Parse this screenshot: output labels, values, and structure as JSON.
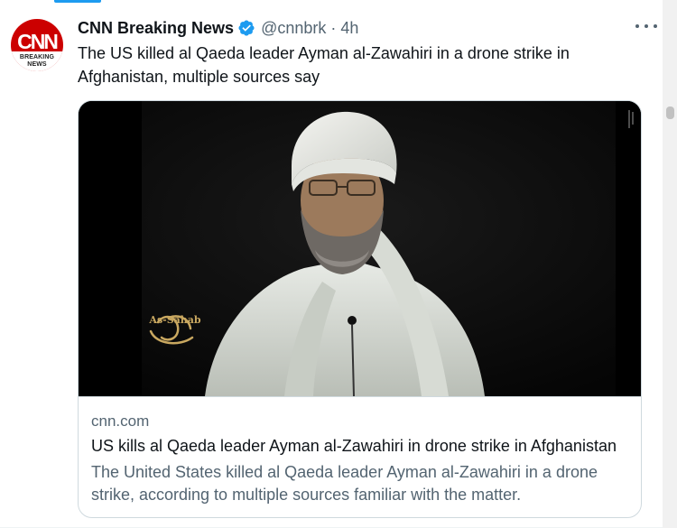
{
  "tweet": {
    "display_name": "CNN Breaking News",
    "handle": "@cnnbrk",
    "separator": "·",
    "time": "4h",
    "text": "The US killed al Qaeda leader Ayman al-Zawahiri in a drone strike in Afghanistan, multiple sources say",
    "avatar": {
      "logo": "CNN",
      "line1": "BREAKING",
      "line2": "NEWS",
      "color": "#cc0000"
    }
  },
  "card": {
    "image_icon": "portrait-photo",
    "watermark_text": "As-Sahab",
    "domain": "cnn.com",
    "title": "US kills al Qaeda leader Ayman al-Zawahiri in drone strike in Afghanistan",
    "description": "The United States killed al Qaeda leader Ayman al-Zawahiri in a drone strike, according to multiple sources familiar with the matter."
  },
  "colors": {
    "accent": "#1d9bf0",
    "verified": "#1d9bf0",
    "secondary_text": "#536471"
  }
}
